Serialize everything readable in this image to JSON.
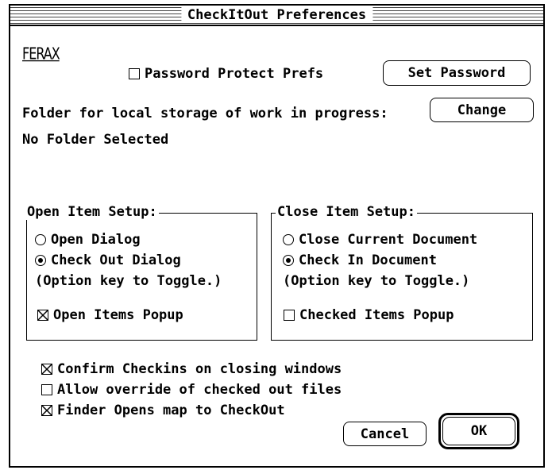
{
  "window": {
    "title": "CheckItOut Preferences"
  },
  "logo": {
    "text": "FERAX"
  },
  "password": {
    "checkbox_label": "Password Protect Prefs",
    "checked": false,
    "set_button": "Set Password"
  },
  "folder": {
    "label": "Folder for local storage of work in progress:",
    "change_button": "Change",
    "value": "No Folder Selected"
  },
  "open_setup": {
    "legend": "Open Item Setup:",
    "options": [
      {
        "label": "Open Dialog",
        "selected": false
      },
      {
        "label": "Check Out Dialog",
        "selected": true
      }
    ],
    "note": "(Option key to Toggle.)",
    "popup_checkbox": {
      "label": "Open Items Popup",
      "checked": true
    }
  },
  "close_setup": {
    "legend": "Close Item Setup:",
    "options": [
      {
        "label": "Close Current Document",
        "selected": false
      },
      {
        "label": "Check In Document",
        "selected": true
      }
    ],
    "note": "(Option key to Toggle.)",
    "popup_checkbox": {
      "label": "Checked Items Popup",
      "checked": false
    }
  },
  "options": [
    {
      "label": "Confirm Checkins on closing windows",
      "checked": true
    },
    {
      "label": "Allow override of checked out files",
      "checked": false
    },
    {
      "label": "Finder Opens map to CheckOut",
      "checked": true
    }
  ],
  "buttons": {
    "cancel": "Cancel",
    "ok": "OK"
  }
}
